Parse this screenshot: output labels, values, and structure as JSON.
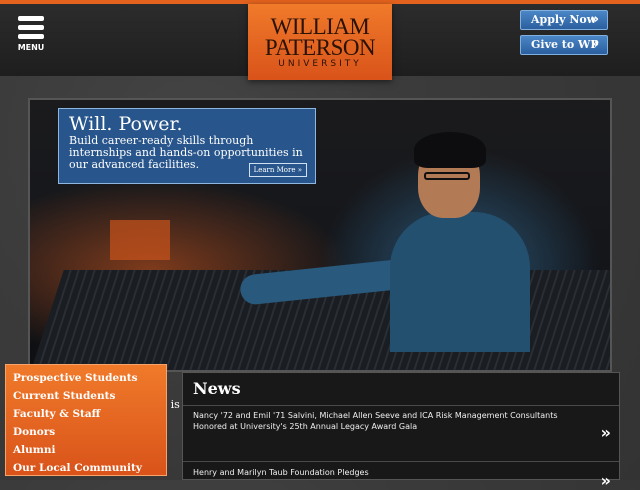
{
  "header": {
    "menu_label": "MENU",
    "logo": {
      "line1": "WILLIAM",
      "line2": "PATERSON",
      "line3": "UNIVERSITY"
    },
    "apply_label": "Apply Now",
    "give_label": "Give to WP",
    "chevron": "»"
  },
  "hero": {
    "title": "Will. Power.",
    "text": "Build career-ready skills through internships and hands-on opportunities in our advanced facilities.",
    "learn_more": "Learn More »",
    "hidden_caption": "n is"
  },
  "audience_menu": {
    "items": [
      "Prospective Students",
      "Current Students",
      "Faculty & Staff",
      "Donors",
      "Alumni",
      "Our Local Community"
    ]
  },
  "news": {
    "title": "News",
    "items": [
      {
        "text": "Nancy '72 and Emil '71 Salvini, Michael Allen Seeve and ICA Risk Management Consultants Honored at University's 25th Annual Legacy Award Gala",
        "arrow": "»"
      },
      {
        "text": "Henry and Marilyn Taub Foundation Pledges",
        "arrow": "»"
      }
    ]
  },
  "colors": {
    "accent": "#e2621e",
    "button_blue": "#2b5f9e",
    "hero_box": "#2a60a0"
  }
}
